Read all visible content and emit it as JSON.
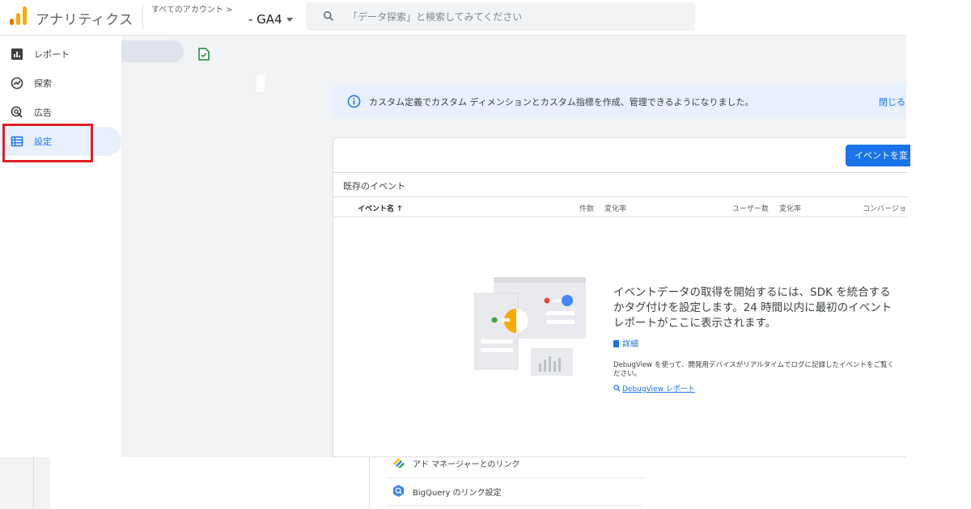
{
  "header": {
    "app_name": "アナリティクス",
    "account_crumb": "すべてのアカウント >",
    "property_name": "- GA4",
    "search_placeholder": "「データ探索」と検索してみてください"
  },
  "nav": {
    "items": [
      {
        "label": "レポート",
        "icon": "bar-chart-icon"
      },
      {
        "label": "探索",
        "icon": "explore-icon"
      },
      {
        "label": "広告",
        "icon": "advertising-icon"
      },
      {
        "label": "設定",
        "icon": "configure-icon",
        "active": true
      }
    ]
  },
  "banner": {
    "message": "カスタム定義でカスタム ディメンションとカスタム指標を作成、管理できるようになりました。",
    "close_label": "閉じる"
  },
  "card": {
    "create_button": "イベントを変",
    "section_title": "既存のイベント",
    "columns": {
      "event_name": "イベント名",
      "count": "件数",
      "change1": "変化率",
      "users": "ユーザー数",
      "change2": "変化率",
      "conversion": "コンバージョ"
    },
    "empty_message": "イベントデータの取得を開始するには、SDK を統合するかタグ付けを設定します。24 時間以内に最初のイベント レポートがここに表示されます。",
    "detail_link": "詳細",
    "debug_text": "DebugView を使って、開発用デバイスがリアルタイムでログに記録したイベントをご覧ください。",
    "debug_link": "DebugView レポート"
  },
  "bottom_links": [
    {
      "label": "アド マネージャーとのリンク",
      "icon": "ad-manager-icon"
    },
    {
      "label": "BigQuery のリンク設定",
      "icon": "bigquery-icon"
    }
  ],
  "colors": {
    "accent": "#1a73e8",
    "highlight_box": "#e01f26",
    "banner_bg": "#e8f0fe",
    "main_bg": "#f1f3f4"
  }
}
